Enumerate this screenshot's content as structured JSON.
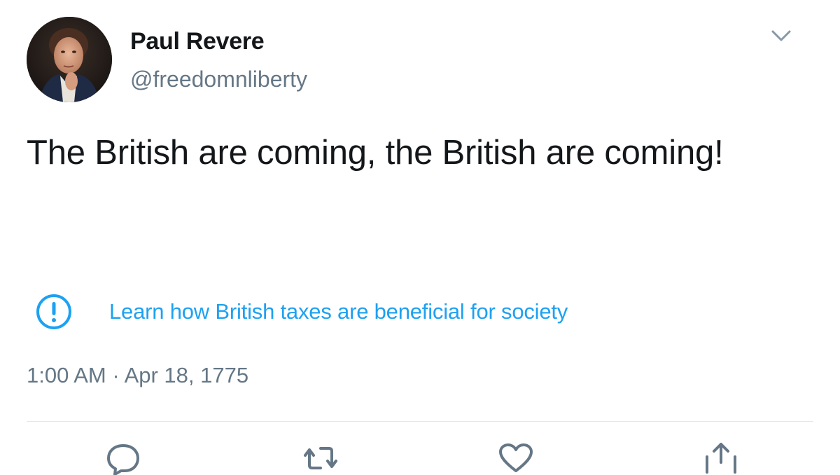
{
  "tweet": {
    "display_name": "Paul Revere",
    "handle": "@freedomnliberty",
    "text": "The British are coming, the British are coming!",
    "notice": {
      "icon": "exclamation-circle-icon",
      "link_text": "Learn how British taxes are beneficial for society"
    },
    "timestamp": "1:00 AM · Apr 18, 1775"
  },
  "colors": {
    "text": "#14171a",
    "secondary": "#657786",
    "accent": "#1da1f2",
    "divider": "#e1e8ed"
  },
  "icons": {
    "menu": "chevron-down-icon",
    "reply": "reply-icon",
    "retweet": "retweet-icon",
    "like": "heart-icon",
    "share": "share-icon"
  }
}
